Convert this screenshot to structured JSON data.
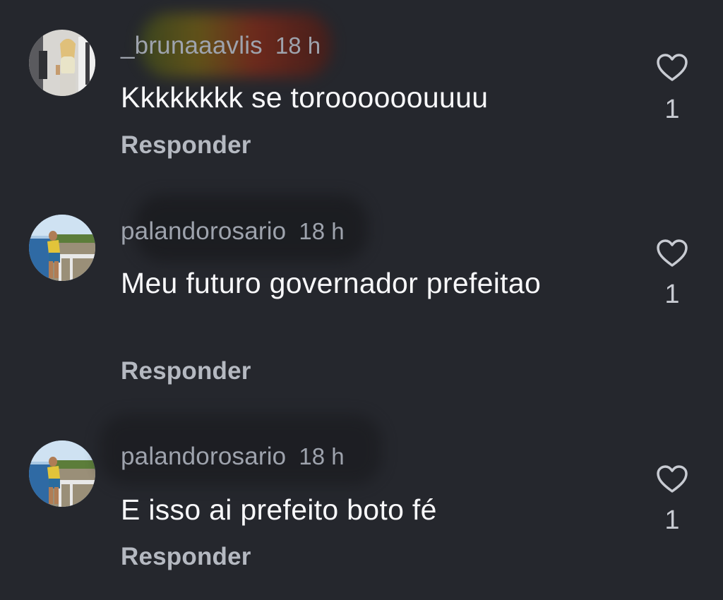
{
  "comments": [
    {
      "username": "_brunaaavlis",
      "time": "18 h",
      "text": "Kkkkkkkk se toroooooouuuu",
      "reply_label": "Responder",
      "like_count": "1",
      "avatar_icon": "profile-photo-icon"
    },
    {
      "username": "palandorosario",
      "time": "18 h",
      "text": "Meu futuro governador prefeitao",
      "reply_label": "Responder",
      "like_count": "1",
      "avatar_icon": "profile-photo-icon"
    },
    {
      "username": "palandorosario",
      "time": "18 h",
      "text": "E isso ai prefeito boto fé",
      "reply_label": "Responder",
      "like_count": "1",
      "avatar_icon": "profile-photo-icon"
    }
  ],
  "icons": {
    "like": "heart-outline-icon"
  },
  "colors": {
    "background": "#25272d",
    "username": "#9ea3ad",
    "comment_text": "#f8f8fa",
    "reply": "#b5b9c1"
  }
}
